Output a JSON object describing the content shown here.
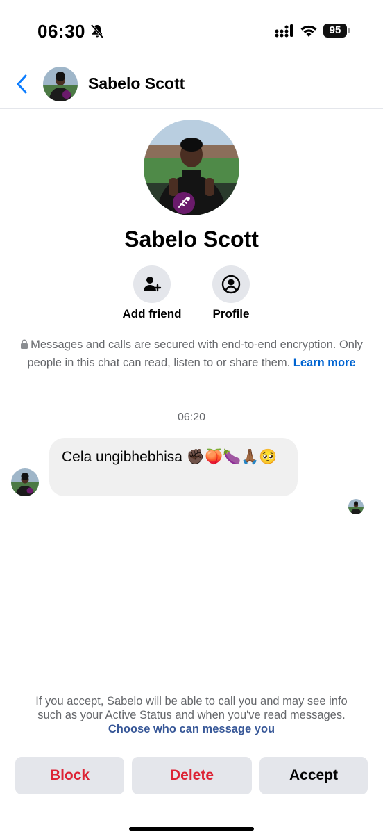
{
  "status_bar": {
    "time": "06:30",
    "battery": "95"
  },
  "header": {
    "name": "Sabelo Scott"
  },
  "profile": {
    "name": "Sabelo Scott",
    "actions": [
      {
        "label": "Add friend",
        "icon": "add-person-icon"
      },
      {
        "label": "Profile",
        "icon": "person-circle-icon"
      }
    ]
  },
  "encryption": {
    "text": "Messages and calls are secured with end-to-end encryption. Only people in this chat can read, listen to or share them.",
    "link": "Learn more"
  },
  "messages": [
    {
      "time": "06:20",
      "text": "Cela ungibhebhisa ✊🏿🍑🍆🙏🏾🥺"
    }
  ],
  "request": {
    "notice": "If you accept, Sabelo will be able to call you and may see info such as your Active Status and when you've read messages.",
    "link": "Choose who can message you",
    "buttons": {
      "block": "Block",
      "delete": "Delete",
      "accept": "Accept"
    }
  },
  "colors": {
    "accent": "#0064d1",
    "danger": "#dd2334",
    "button_bg": "#e4e6eb"
  }
}
